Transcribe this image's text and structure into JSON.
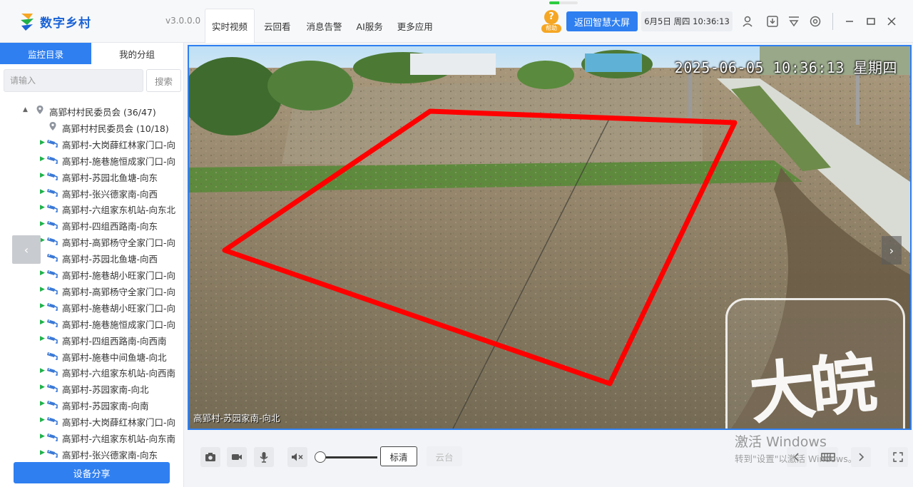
{
  "header": {
    "app_title": "数字乡村",
    "version": "v3.0.0.0",
    "nav": [
      "实时视频",
      "云回看",
      "消息告警",
      "AI服务",
      "更多应用"
    ],
    "active_nav": 0,
    "help_label": "帮助",
    "return_button": "返回智慧大屏",
    "datetime": "6月5日 周四 10:36:13",
    "icons": [
      "user-icon",
      "download-icon",
      "filter-icon",
      "settings-icon",
      "minimize-icon",
      "maximize-icon",
      "close-icon"
    ]
  },
  "sidebar": {
    "tabs": [
      "监控目录",
      "我的分组"
    ],
    "active_tab": 0,
    "search_placeholder": "请输入",
    "search_button": "搜索",
    "root": "高郢村村民委员会 (36/47)",
    "items": [
      {
        "label": "高郢村村民委员会 (10/18)",
        "kind": "group"
      },
      {
        "label": "高郢村-大岗薛红林家门口-向",
        "kind": "camera",
        "online": true
      },
      {
        "label": "高郢村-施巷施恒成家门口-向",
        "kind": "camera",
        "online": true
      },
      {
        "label": "高郢村-苏园北鱼塘-向东",
        "kind": "camera",
        "online": true
      },
      {
        "label": "高郢村-张兴德家南-向西",
        "kind": "camera",
        "online": true
      },
      {
        "label": "高郢村-六组家东机站-向东北",
        "kind": "camera",
        "online": true
      },
      {
        "label": "高郢村-四组西路南-向东",
        "kind": "camera",
        "online": true
      },
      {
        "label": "高郢村-高郢杨守全家门口-向",
        "kind": "camera",
        "online": true
      },
      {
        "label": "高郢村-苏园北鱼塘-向西",
        "kind": "camera",
        "online": false
      },
      {
        "label": "高郢村-施巷胡小旺家门口-向",
        "kind": "camera",
        "online": true
      },
      {
        "label": "高郢村-高郢杨守全家门口-向",
        "kind": "camera",
        "online": true
      },
      {
        "label": "高郢村-施巷胡小旺家门口-向",
        "kind": "camera",
        "online": true
      },
      {
        "label": "高郢村-施巷施恒成家门口-向",
        "kind": "camera",
        "online": true
      },
      {
        "label": "高郢村-四组西路南-向西南",
        "kind": "camera",
        "online": true
      },
      {
        "label": "高郢村-施巷中间鱼塘-向北",
        "kind": "camera",
        "online": false
      },
      {
        "label": "高郢村-六组家东机站-向西南",
        "kind": "camera",
        "online": true
      },
      {
        "label": "高郢村-苏园家南-向北",
        "kind": "camera",
        "online": true
      },
      {
        "label": "高郢村-苏园家南-向南",
        "kind": "camera",
        "online": true
      },
      {
        "label": "高郢村-大岗薛红林家门口-向",
        "kind": "camera",
        "online": true
      },
      {
        "label": "高郢村-六组家东机站-向东南",
        "kind": "camera",
        "online": true
      },
      {
        "label": "高郢村-张兴德家南-向东",
        "kind": "camera",
        "online": true
      }
    ],
    "share_button": "设备分享"
  },
  "video": {
    "osd_time": "2025-06-05 10:36:13 星期四",
    "camera_label": "高郢村-苏园家南-向北",
    "watermark": "大皖"
  },
  "controls": {
    "quality": "标清",
    "ptz": "云台",
    "volume_percent": 0,
    "icons": [
      "snapshot-icon",
      "record-icon",
      "mic-icon",
      "mute-icon"
    ]
  },
  "os_overlay": {
    "line1": "激活 Windows",
    "line2": "转到\"设置\"以激活 Windows。"
  },
  "colors": {
    "accent": "#2f7ff0",
    "online": "#1fb24a",
    "roi": "#ff0000"
  }
}
